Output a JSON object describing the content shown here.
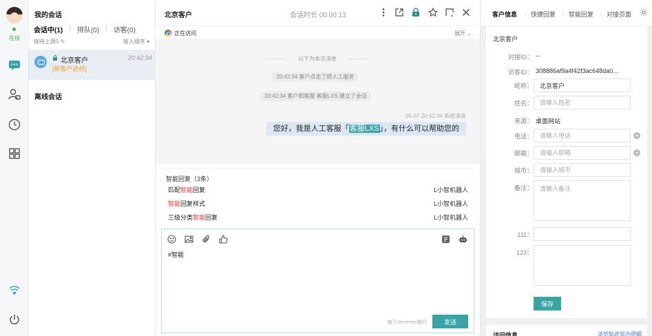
{
  "rail": {
    "status": "在线"
  },
  "sessions": {
    "title": "我的会话",
    "tabs": [
      {
        "label": "会话中(1)"
      },
      {
        "label": "排队(0)"
      },
      {
        "label": "访客(0)"
      }
    ],
    "limit_label": "接待上限5",
    "sort_label": "接入顺序",
    "items": [
      {
        "name": "北京客户",
        "tag": "[新客户进线]",
        "time": "20:42:34"
      }
    ],
    "offline_title": "离线会话"
  },
  "chat": {
    "title": "北京客户",
    "duration": "会话时长 00:00:13",
    "visiting": "正在访问",
    "expand": "展开",
    "divider": "以下为本次消息",
    "system_messages": [
      "20:42:34 客户点击了转人工服务",
      "20:42:34 客户和客服 客服LXS 建立了会话"
    ],
    "message_meta": "05-07 20:42:34 系统消息",
    "message": {
      "before": "您好，我是人工客服「",
      "highlight": "客服LXS",
      "after": "」，有什么可以帮助您的"
    },
    "smart_reply": {
      "header": "智能回复（3条）",
      "items": [
        {
          "pre": "匹配",
          "key": "智能",
          "post": "回复",
          "by": "L小智机器人"
        },
        {
          "pre": "",
          "key": "智能",
          "post": "回复样式",
          "by": "L小智机器人"
        },
        {
          "pre": "三级分类",
          "key": "智能",
          "post": "回复",
          "by": "L小智机器人"
        }
      ]
    },
    "editor": {
      "content": "#智能",
      "hint": "按下ctrl+enter换行",
      "send_label": "发送"
    }
  },
  "right": {
    "tabs": [
      {
        "label": "客户信息"
      },
      {
        "label": "快捷回复"
      },
      {
        "label": "智能回复"
      },
      {
        "label": "对接页面"
      }
    ],
    "customer_name": "北京客户",
    "fields": {
      "dock_id": {
        "label": "对接ID：",
        "value": "--"
      },
      "visitor_id": {
        "label": "访客ID：",
        "value": "308886af9a4f42f3ac648da0..."
      },
      "nickname": {
        "label": "昵称：",
        "value": "北京客户"
      },
      "fullname": {
        "label": "姓名：",
        "placeholder": "请输入姓名"
      },
      "source": {
        "label": "来源：",
        "value": "桌面网站"
      },
      "phone": {
        "label": "电话：",
        "placeholder": "请输入电话"
      },
      "email": {
        "label": "邮箱：",
        "placeholder": "请输入邮箱"
      },
      "city": {
        "label": "城市：",
        "placeholder": "请输入城市"
      },
      "remark": {
        "label": "备注：",
        "placeholder": "请输入备注"
      },
      "f111": {
        "label": "111："
      },
      "f123": {
        "label": "123："
      }
    },
    "save_label": "保存",
    "visit_title": "访问信息",
    "visit_link": "浏览轨迹显示明细"
  },
  "colors": {
    "accent": "#3aa3a4",
    "keyword": "#e53935",
    "tag": "#f0a030",
    "online": "#4caf50"
  }
}
